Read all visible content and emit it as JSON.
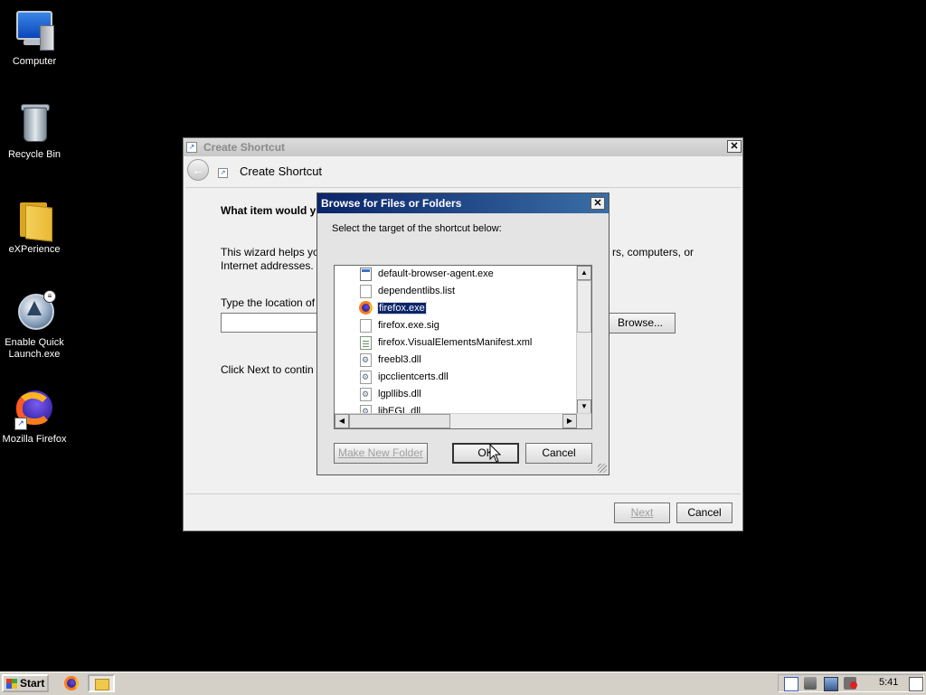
{
  "desktop": {
    "icons": [
      {
        "label": "Computer",
        "icon": "computer-icon"
      },
      {
        "label": "Recycle Bin",
        "icon": "recycle-bin-icon"
      },
      {
        "label": "eXPerience",
        "icon": "folder-icon"
      },
      {
        "label": "Enable Quick Launch.exe",
        "icon": "quick-launch-icon"
      },
      {
        "label": "Mozilla Firefox",
        "icon": "firefox-icon"
      }
    ]
  },
  "wizard": {
    "title": "Create Shortcut",
    "header_title": "Create Shortcut",
    "question": "What item would y",
    "description_left": "This wizard helps yo",
    "description_right": "rs, computers, or",
    "description_line2": "Internet addresses.",
    "location_label": "Type the location of",
    "location_value": "",
    "browse_label": "Browse...",
    "next_note": "Click Next to contin",
    "next_label": "Next",
    "cancel_label": "Cancel"
  },
  "browse_dialog": {
    "title": "Browse for Files or Folders",
    "prompt": "Select the target of the shortcut below:",
    "items": [
      {
        "name": "default-browser-agent.exe",
        "type": "exe"
      },
      {
        "name": "dependentlibs.list",
        "type": "doc"
      },
      {
        "name": "firefox.exe",
        "type": "firefox",
        "selected": true
      },
      {
        "name": "firefox.exe.sig",
        "type": "doc"
      },
      {
        "name": "firefox.VisualElementsManifest.xml",
        "type": "xml"
      },
      {
        "name": "freebl3.dll",
        "type": "dll"
      },
      {
        "name": "ipcclientcerts.dll",
        "type": "dll"
      },
      {
        "name": "lgpllibs.dll",
        "type": "dll"
      },
      {
        "name": "libEGL.dll",
        "type": "dll"
      }
    ],
    "make_new_folder_label": "Make New Folder",
    "ok_label": "OK",
    "cancel_label": "Cancel"
  },
  "taskbar": {
    "start_label": "Start",
    "clock": "5:41"
  }
}
